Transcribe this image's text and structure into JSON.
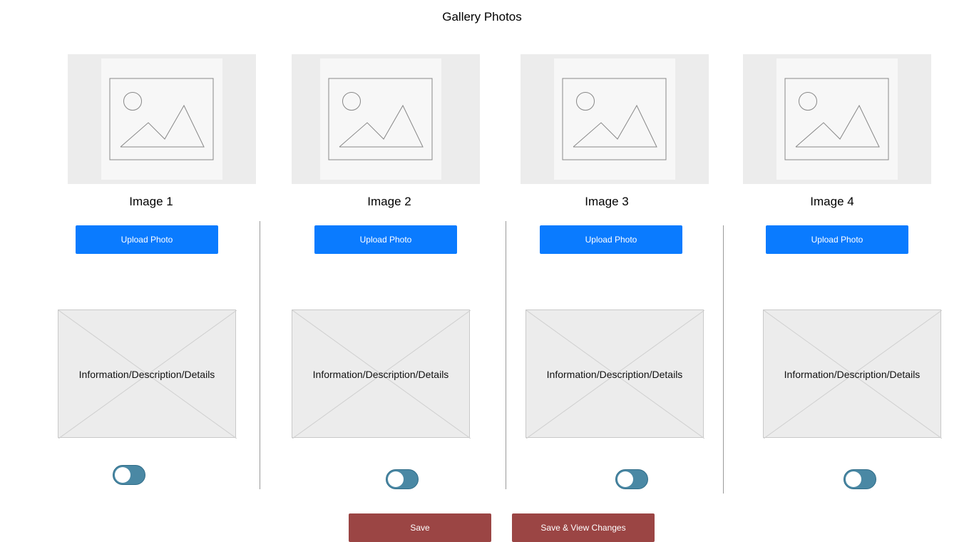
{
  "page": {
    "title": "Gallery Photos"
  },
  "columns": [
    {
      "image_label": "Image 1",
      "upload_label": "Upload Photo",
      "info_text": "Information/Description/Details",
      "toggle_on": true
    },
    {
      "image_label": "Image 2",
      "upload_label": "Upload Photo",
      "info_text": "Information/Description/Details",
      "toggle_on": true
    },
    {
      "image_label": "Image 3",
      "upload_label": "Upload Photo",
      "info_text": "Information/Description/Details",
      "toggle_on": true
    },
    {
      "image_label": "Image 4",
      "upload_label": "Upload Photo",
      "info_text": "Information/Description/Details",
      "toggle_on": true
    }
  ],
  "footer": {
    "save_label": "Save",
    "save_view_label": "Save & View Changes"
  },
  "colors": {
    "upload_button": "#0a7bff",
    "save_button": "#9b4544",
    "toggle": "#4a88a4"
  },
  "icons": {
    "image_placeholder": "image-placeholder-icon",
    "info_placeholder": "cross-placeholder-icon"
  }
}
